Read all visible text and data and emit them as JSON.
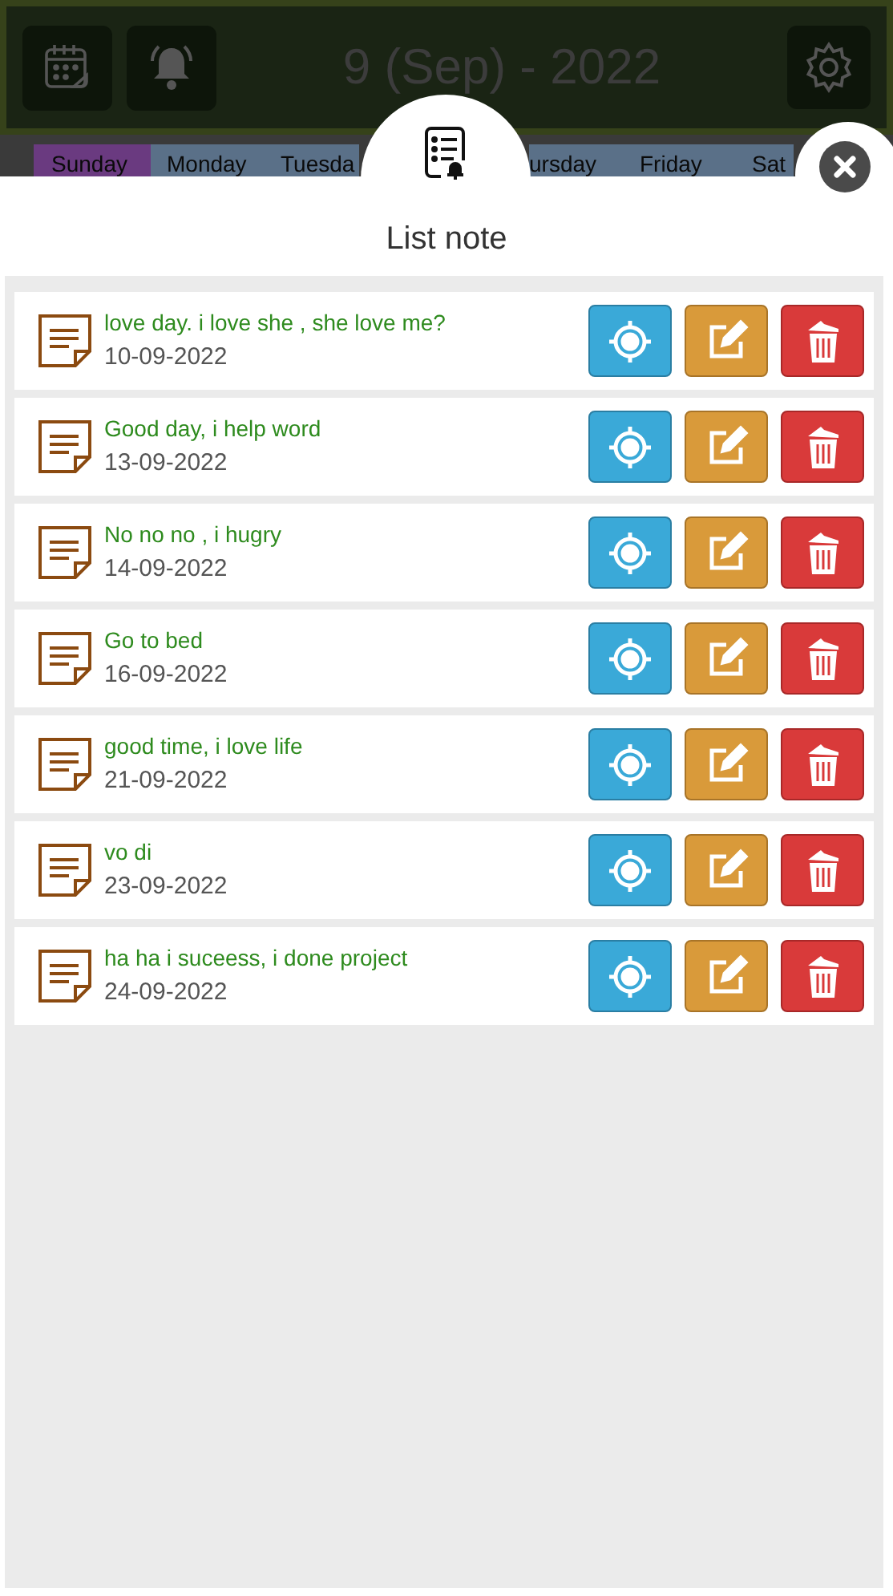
{
  "header": {
    "title": "9 (Sep) - 2022"
  },
  "days": [
    {
      "label": "Sunday",
      "selected": true
    },
    {
      "label": "Monday",
      "selected": false
    },
    {
      "label": "Tuesda",
      "selected": false
    },
    {
      "label": "ursday",
      "selected": false
    },
    {
      "label": "Friday",
      "selected": false
    },
    {
      "label": "Sat",
      "selected": false
    }
  ],
  "sheet": {
    "title": "List note"
  },
  "notes": [
    {
      "text": "love day. i love she , she love me?",
      "date": "10-09-2022"
    },
    {
      "text": "Good day, i help word",
      "date": "13-09-2022"
    },
    {
      "text": "No no no , i hugry",
      "date": "14-09-2022"
    },
    {
      "text": "Go to bed",
      "date": "16-09-2022"
    },
    {
      "text": "good time, i love life",
      "date": "21-09-2022"
    },
    {
      "text": "vo di",
      "date": "23-09-2022"
    },
    {
      "text": "ha ha i suceess, i done project",
      "date": "24-09-2022"
    }
  ]
}
